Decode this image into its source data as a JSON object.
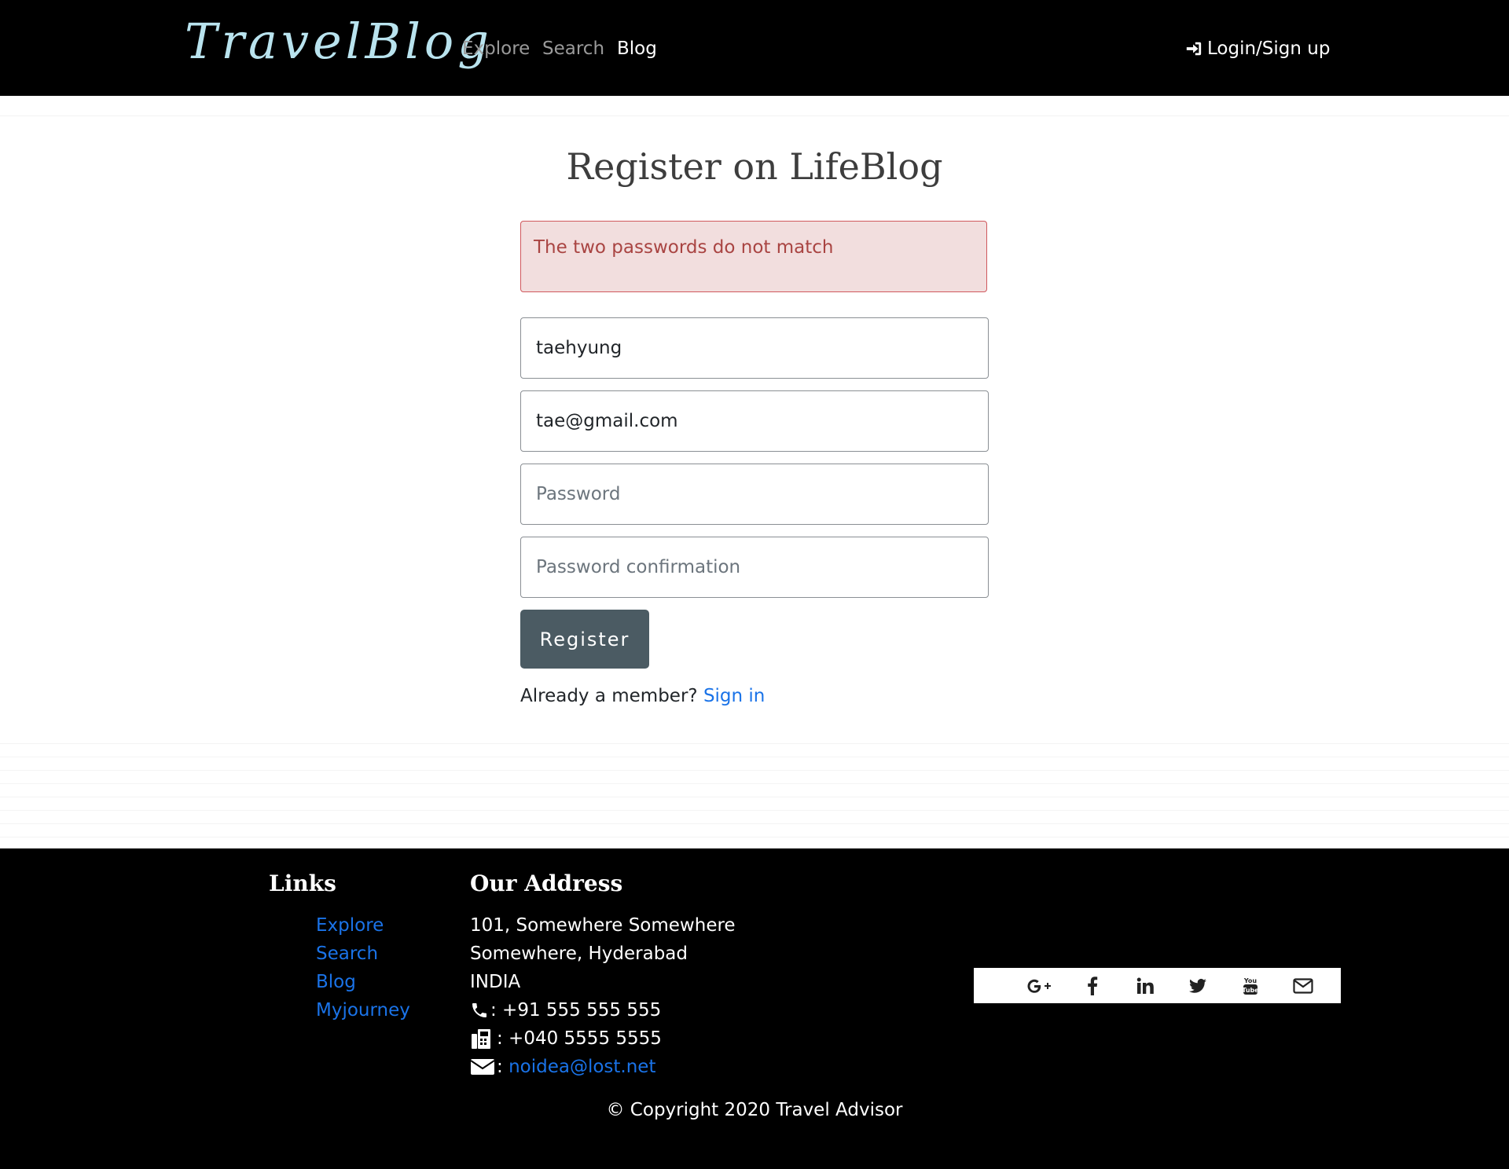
{
  "nav": {
    "brand": "TravelBlog",
    "links": [
      "Explore",
      "Search",
      "Blog"
    ],
    "active": "Blog",
    "login_label": "Login/Sign up"
  },
  "main": {
    "title": "Register on LifeBlog",
    "alert": "The two passwords do not match",
    "fields": {
      "username": {
        "value": "taehyung"
      },
      "email": {
        "value": "tae@gmail.com"
      },
      "password": {
        "placeholder": "Password"
      },
      "password_confirmation": {
        "placeholder": "Password confirmation"
      }
    },
    "register_label": "Register",
    "member_text": "Already a member?",
    "signin_label": "Sign in"
  },
  "footer": {
    "links_heading": "Links",
    "links": [
      "Explore",
      "Search",
      "Blog",
      "Myjourney"
    ],
    "address_heading": "Our Address",
    "address_lines": [
      "101, Somewhere Somewhere",
      "Somewhere, Hyderabad",
      "INDIA"
    ],
    "phone": ": +91 555 555 555",
    "fax": ": +040 5555 5555",
    "email_prefix": ":",
    "email": "noidea@lost.net",
    "social_icons": [
      "google-plus-icon",
      "facebook-icon",
      "linkedin-icon",
      "twitter-icon",
      "youtube-icon",
      "envelope-icon"
    ],
    "copyright": "© Copyright 2020 Travel Advisor"
  },
  "colors": {
    "navbar_bg": "#000000",
    "brand": "#b9e3ee",
    "alert_bg": "#f2dede",
    "alert_text": "#a94442",
    "button_bg": "#4b5b63",
    "link": "#1a73e8"
  }
}
